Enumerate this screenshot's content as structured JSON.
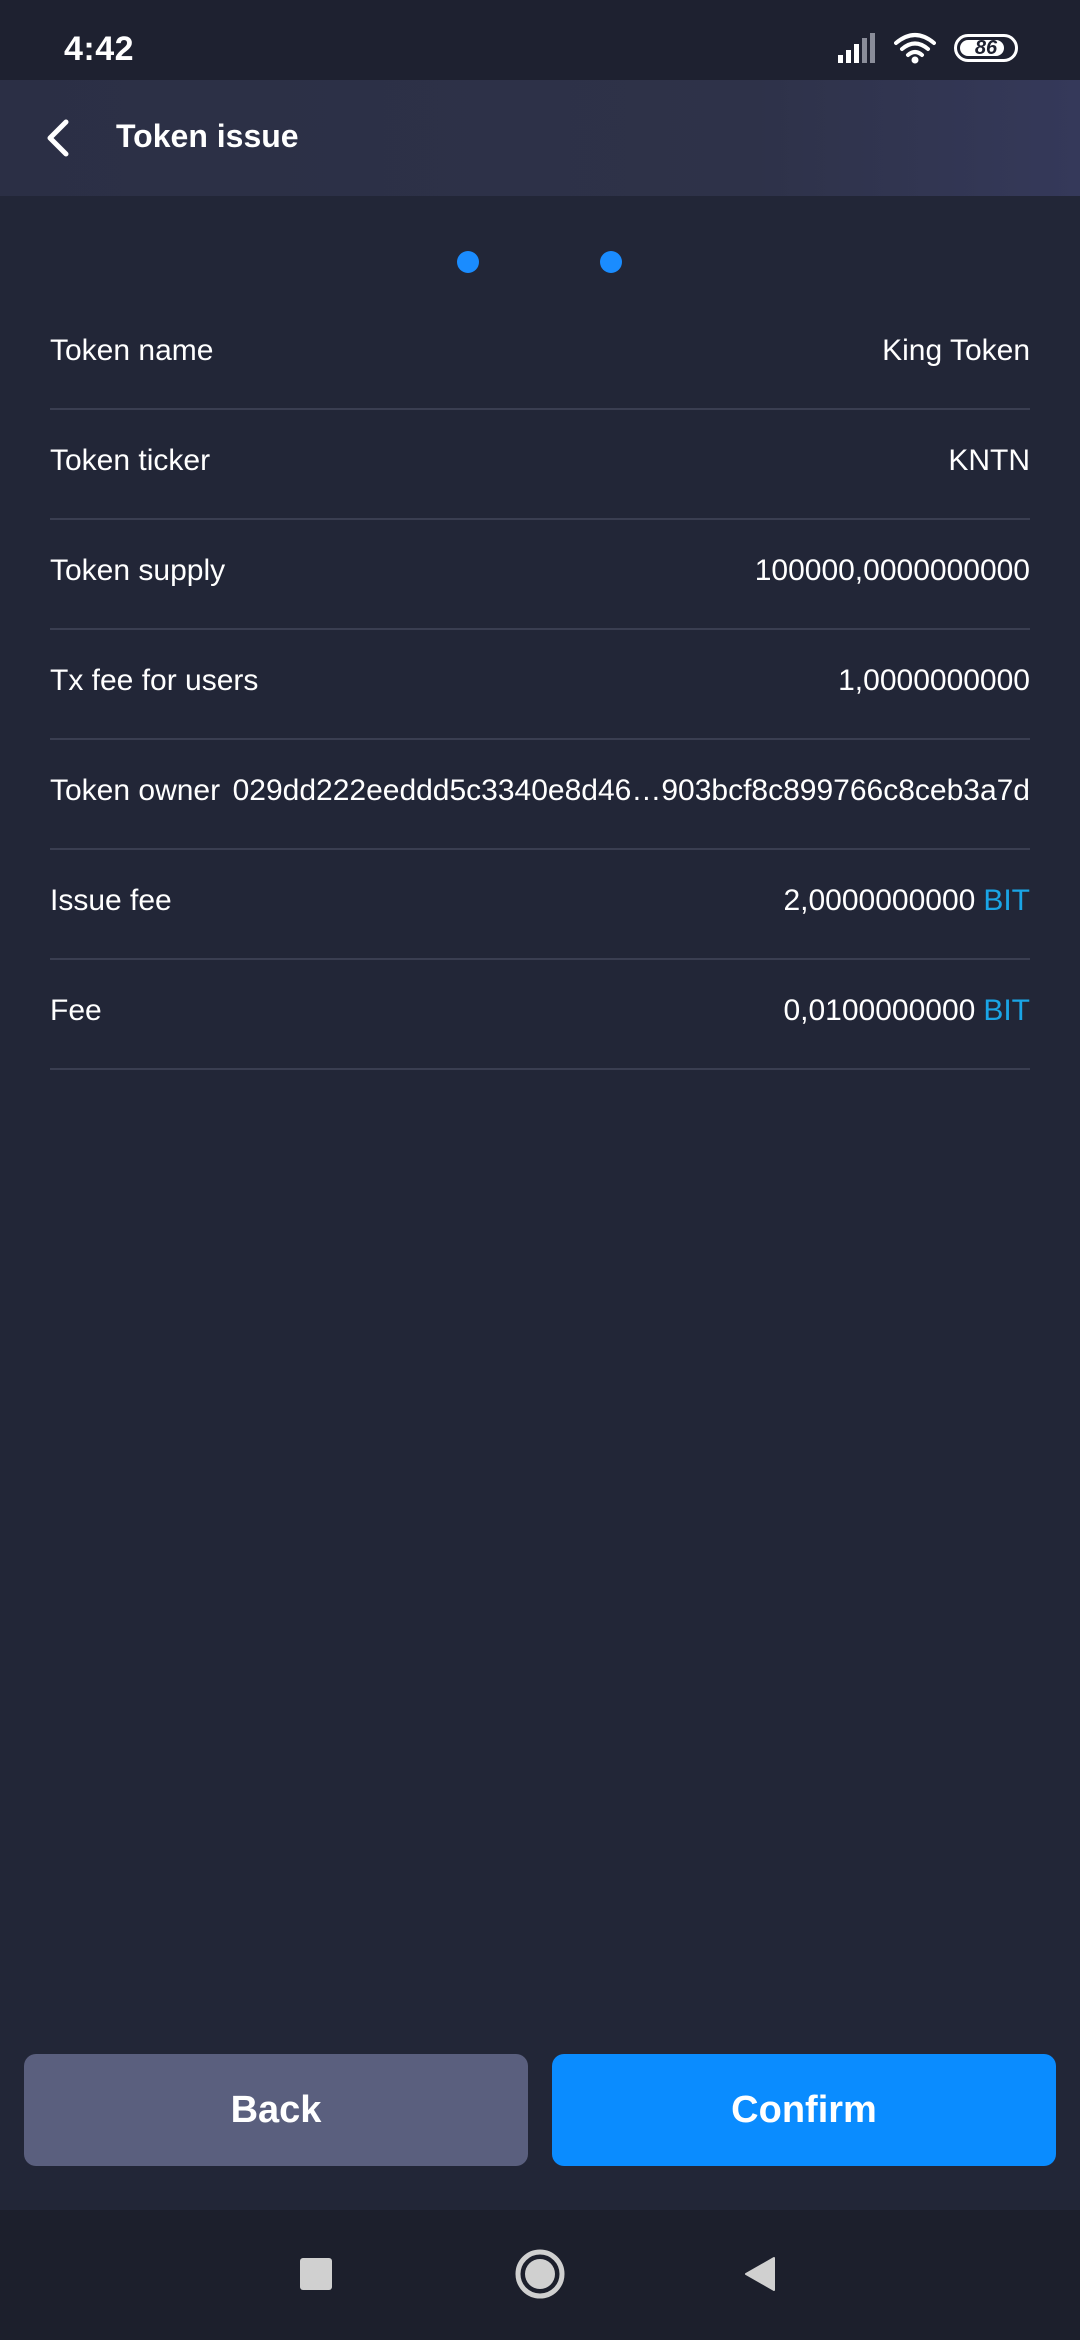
{
  "status_bar": {
    "time": "4:42",
    "battery": "86",
    "icons": [
      "signal-icon",
      "wifi-icon",
      "battery-icon"
    ]
  },
  "header": {
    "title": "Token issue",
    "back_icon": "chevron-left-icon"
  },
  "details": [
    {
      "label": "Token name",
      "value": "King Token"
    },
    {
      "label": "Token ticker",
      "value": "KNTN"
    },
    {
      "label": "Token supply",
      "value": "100000,0000000000"
    },
    {
      "label": "Tx fee for users",
      "value": "1,0000000000"
    },
    {
      "label": "Token owner",
      "value": "029dd222eeddd5c3340e8d46…903bcf8c899766c8ceb3a7d"
    },
    {
      "label": "Issue fee",
      "value": "2,0000000000",
      "unit": "BIT"
    },
    {
      "label": "Fee",
      "value": "0,0100000000",
      "unit": "BIT"
    }
  ],
  "buttons": {
    "back": "Back",
    "confirm": "Confirm"
  },
  "colors": {
    "background": "#222637",
    "accent": "#0a8cff",
    "unit": "#1aa5e6",
    "secondary_button": "#5a5f7e"
  },
  "nav_bar": {
    "icons": [
      "recents-icon",
      "home-icon",
      "back-triangle-icon"
    ]
  }
}
